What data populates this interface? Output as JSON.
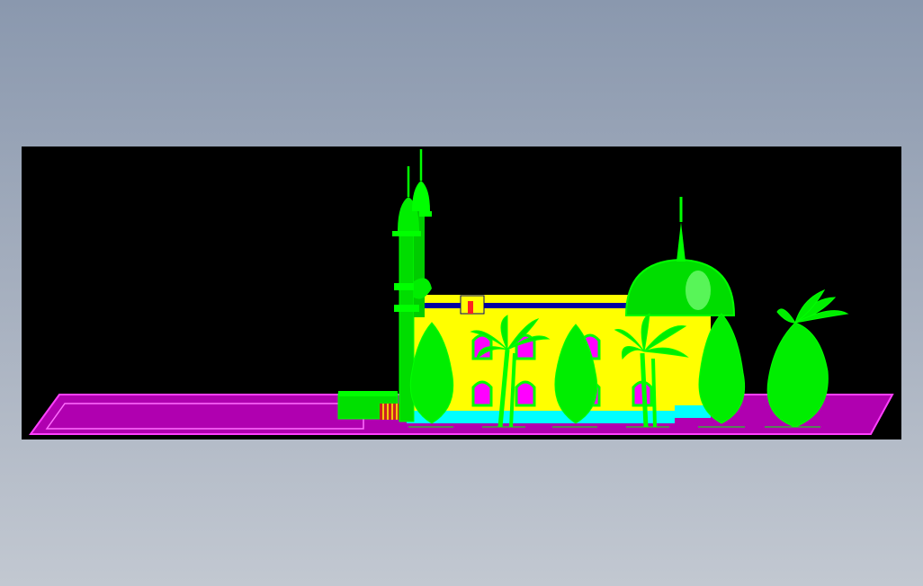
{
  "viewer": {
    "background": "#000000",
    "window_background": "#a3adbd"
  },
  "scene": {
    "subject": "mosque-model",
    "colors": {
      "platform": "#c000c0",
      "platform_edge": "#ff40ff",
      "wall": "#ffff00",
      "green": "#00ff00",
      "green_dark": "#00b000",
      "window": "#ff00ff",
      "base": "#00ffff",
      "roof_trim": "#0000a0",
      "red": "#ff2020"
    }
  }
}
